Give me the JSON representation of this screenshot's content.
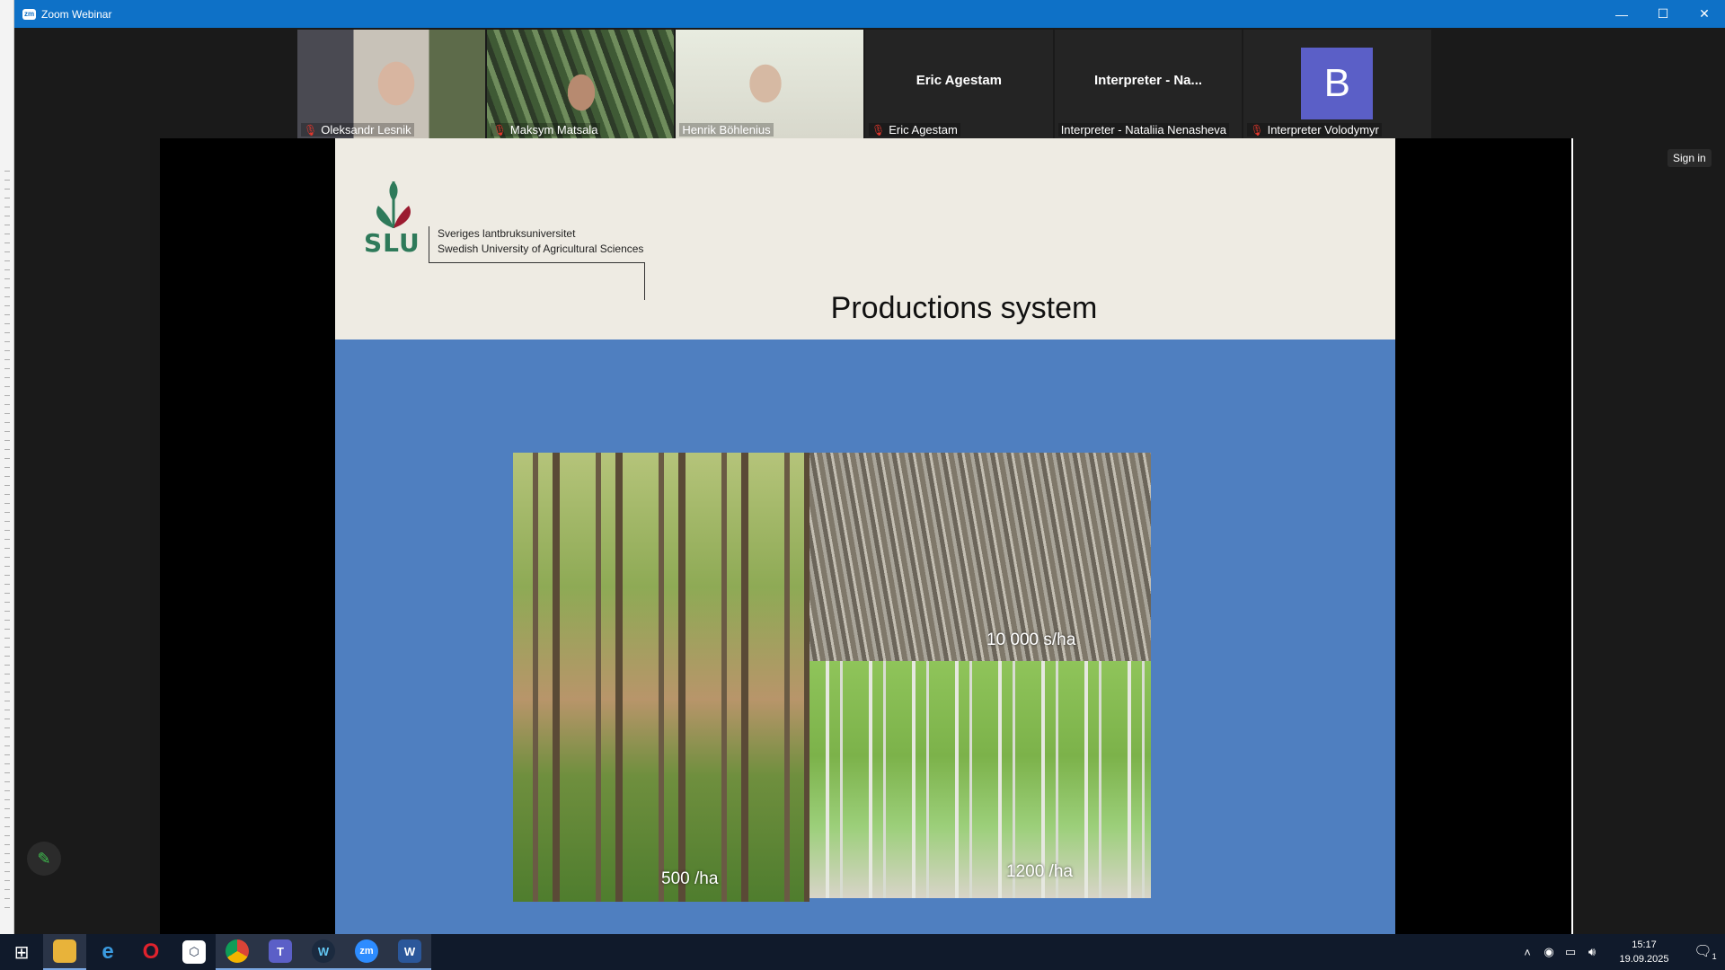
{
  "window": {
    "title": "Zoom Webinar",
    "app_icon_text": "zm",
    "minimize": "—",
    "maximize": "☐",
    "close": "✕"
  },
  "participants": [
    {
      "name": "Oleksandr Lesnik",
      "muted": true,
      "video": true
    },
    {
      "name": "Maksym Matsala",
      "muted": true,
      "video": true
    },
    {
      "name": "Henrik Böhlenius",
      "muted": false,
      "video": true,
      "active_speaker": true
    },
    {
      "name": "Eric Agestam",
      "display": "Eric Agestam",
      "muted": true,
      "video": false
    },
    {
      "name": "Interpreter - Nataliia Nenasheva",
      "display": "Interpreter - Na...",
      "muted": false,
      "video": false
    },
    {
      "name": "Interpreter Volodymyr",
      "avatar_letter": "B",
      "muted": true,
      "video": false
    }
  ],
  "share": {
    "sign_in": "Sign in"
  },
  "slide": {
    "logo_text": "SLU",
    "org_name_sv": "Sveriges lantbruksuniversitet",
    "org_name_en": "Swedish University of Agricultural Sciences",
    "title": "Productions system",
    "photos": [
      {
        "label": "500 /ha"
      },
      {
        "label": "10 000 s/ha"
      },
      {
        "label": "1200 /ha"
      }
    ]
  },
  "annotate_icon": "pencil-icon",
  "taskbar": {
    "apps": [
      "windows-start",
      "file-explorer",
      "internet-explorer",
      "opera",
      "app-launcher",
      "chrome",
      "teams",
      "webex",
      "zoom",
      "word"
    ],
    "clock_time": "15:17",
    "clock_date": "19.09.2025",
    "notification_count": "1"
  },
  "colors": {
    "titlebar": "#0e71c7",
    "slide_bg": "#4f7fc0",
    "slide_header": "#eeebe3",
    "slu_green": "#2e7a5a",
    "slu_red": "#9b1b30"
  }
}
